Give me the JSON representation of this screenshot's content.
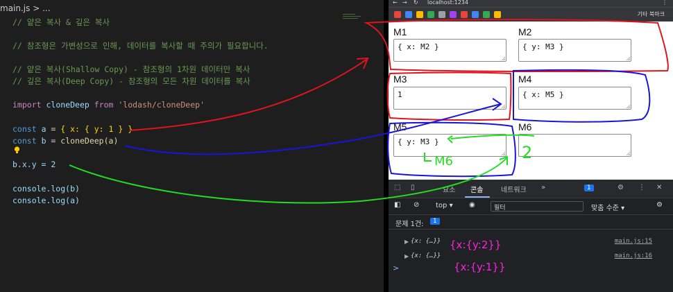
{
  "editor": {
    "breadcrumb": "main.js > ...",
    "lines": [
      "// 얕은 복사 & 깊은 복사",
      "// 참조형은 가변성으로 인해, 데이터를 복사할 때 주의가 필요합니다.",
      "// 얕은 복사(Shallow Copy) - 참조형의 1차원 데이터만 복사",
      "// 깊은 복사(Deep Copy) - 참조형의 모든 차원 데이터를 복사"
    ],
    "import_kw": "import",
    "import_name": "cloneDeep",
    "from_kw": "from",
    "import_path": "'lodash/cloneDeep'",
    "const_kw": "const",
    "var_a": "a",
    "var_b": "b",
    "a_value": "{ x: { y: 1 } }",
    "b_value": "cloneDeep(a)",
    "assign_line": "b.x.y = 2",
    "log_b": "console.log(b)",
    "log_a": "console.log(a)"
  },
  "browser": {
    "url": "localhost:1234",
    "bookmarks_label": "기타 북마크",
    "memory": [
      {
        "label": "M1",
        "value": "{ x: M2 }"
      },
      {
        "label": "M2",
        "value": "{ y: M3 }"
      },
      {
        "label": "M3",
        "value": "1"
      },
      {
        "label": "M4",
        "value": "{ x: M5 }"
      },
      {
        "label": "M5",
        "value": "{ y: M3 }"
      },
      {
        "label": "M6",
        "value": ""
      }
    ]
  },
  "devtools": {
    "tabs": [
      "요소",
      "콘솔",
      "네트워크",
      "»"
    ],
    "issue_count_badge": "1",
    "context": "top",
    "filter_placeholder": "필터",
    "level": "맞춤 수준",
    "issues_label": "문제 1건:",
    "issues_count": "1",
    "logs": [
      {
        "value": "{x: {…}}",
        "source": "main.js:15"
      },
      {
        "value": "{x: {…}}",
        "source": "main.js:16"
      }
    ],
    "prompt": ">"
  },
  "annotations": {
    "m6_label": "M6",
    "two": "2",
    "log1_hand": "{x:{y:2}}",
    "log2_hand": "{x:{y:1}}"
  },
  "colors": {
    "red": "#e0141e",
    "blue": "#1a14d8",
    "green": "#22dd22",
    "magenta": "#ff22dd"
  }
}
